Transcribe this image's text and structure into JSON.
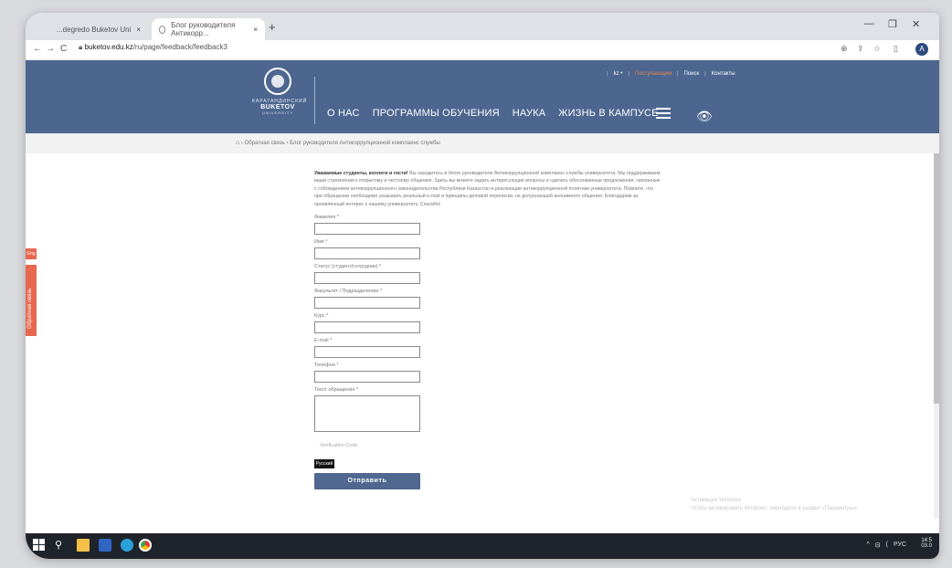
{
  "browser": {
    "tabs": [
      {
        "label": "...degredo Buketov Uni",
        "close": "×"
      },
      {
        "label": "Блог руководителя Антикорр...",
        "close": "×"
      }
    ],
    "new_tab": "+",
    "window_controls": [
      "—",
      "❐",
      "✕"
    ],
    "nav": {
      "back": "←",
      "forward": "→",
      "reload": "C"
    },
    "url_domain": "buketov.edu.kz",
    "url_path": "/ru/page/feedback/feedback3",
    "toolbar_icons": [
      "⊕",
      "⇪",
      "☆",
      "▯"
    ],
    "profile_initial": "A"
  },
  "site": {
    "logo": {
      "line1": "КАРАГАНДИНСКИЙ",
      "line2": "BUKETOV",
      "line3": "UNIVERSITY"
    },
    "top_menu": [
      "|",
      "kz •",
      "|",
      "Поступающим",
      "|",
      "Поиск",
      "|",
      "Контакты"
    ],
    "main_nav": [
      "О НАС",
      "ПРОГРАММЫ ОБУЧЕНИЯ",
      "НАУКА",
      "ЖИЗНЬ В КАМПУСЕ"
    ],
    "breadcrumb": {
      "home": "⌂",
      "sep": "›",
      "item1": "Обратная связь",
      "item2": "Блог руководителя Антикоррупционной комплаенс службы"
    },
    "side_tabs": {
      "eng": "Eng",
      "feedback": "Обратная связь"
    }
  },
  "form": {
    "intro_bold": "Уважаемые студенты, коллеги и гости!",
    "intro_text": " Вы находитесь в блоге руководителя Антикоррупционной комплаенс-службы университета. Мы поддерживаем ваши стремления к открытому и честному общению. Здесь вы можете задать интересующие вопросы и сделать обоснованные предложения, связанные с соблюдением антикоррупционного законодательства Республики Казахстан и реализации антикоррупционной политики университета. Помните, что при обращении необходимо указывать реальный e-mail и принципы деловой переписки, не допускающей анонимного общения. Благодарим за проявленный интерес к нашему университету. Спасибо!",
    "fields": [
      {
        "label": "Фамилия *"
      },
      {
        "label": "Имя *"
      },
      {
        "label": "Статус (студент/сотрудник) *"
      },
      {
        "label": "Факультет / Подразделение *"
      },
      {
        "label": "Курс *"
      },
      {
        "label": "E-mail *"
      },
      {
        "label": "Телефон *"
      }
    ],
    "message_label": "Текст обращения *",
    "captcha_placeholder": "Verification Code",
    "lang_button": "Русский",
    "submit": "Отправить"
  },
  "watermark": {
    "line1": "Активация Windows",
    "line2": "Чтобы активировать Windows, перейдите в раздел «Параметры»."
  },
  "taskbar": {
    "tray": [
      "^",
      "⊟",
      "(",
      "РУС"
    ],
    "clock_time": "14:5",
    "clock_date": "03.0"
  }
}
